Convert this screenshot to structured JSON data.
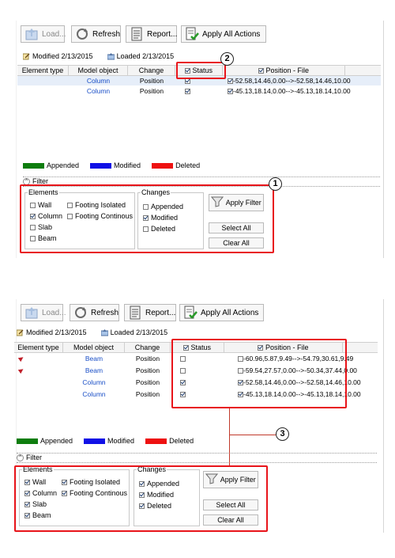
{
  "toolbar": {
    "load": "Load...",
    "refresh": "Refresh",
    "report": "Report...",
    "apply_all": "Apply All Actions"
  },
  "status": {
    "modified": "Modified 2/13/2015",
    "loaded": "Loaded 2/13/2015"
  },
  "grid": {
    "columns": [
      "Element type",
      "Model object",
      "Change",
      "Status",
      "Position - File"
    ],
    "rows_top": [
      {
        "element_type": "",
        "model_object": "Column",
        "change": "Position",
        "status": true,
        "file_checked": true,
        "position": "-52.58,14.46,0.00-->-52.58,14.46,10.00"
      },
      {
        "element_type": "",
        "model_object": "Column",
        "change": "Position",
        "status": true,
        "file_checked": true,
        "position": "-45.13,18.14,0.00-->-45.13,18.14,10.00"
      }
    ],
    "rows_bottom": [
      {
        "element_type": "",
        "model_object": "Beam",
        "change": "Position",
        "status": false,
        "file_checked": false,
        "position": "-60.96,5.87,9.49-->-54.79,30.61,9.49"
      },
      {
        "element_type": "",
        "model_object": "Beam",
        "change": "Position",
        "status": false,
        "file_checked": false,
        "position": "-59.54,27.57,0.00-->-50.34,37.44,0.00"
      },
      {
        "element_type": "",
        "model_object": "Column",
        "change": "Position",
        "status": true,
        "file_checked": true,
        "position": "-52.58,14.46,0.00-->-52.58,14.46,10.00"
      },
      {
        "element_type": "",
        "model_object": "Column",
        "change": "Position",
        "status": true,
        "file_checked": true,
        "position": "-45.13,18.14,0.00-->-45.13,18.14,10.00"
      }
    ]
  },
  "legend": {
    "appended": "Appended",
    "modified": "Modified",
    "deleted": "Deleted",
    "appended_color": "#0e7d0e",
    "modified_color": "#1010e6",
    "deleted_color": "#ee1111"
  },
  "filter": {
    "label": "Filter",
    "elements_title": "Elements",
    "changes_title": "Changes",
    "wall": "Wall",
    "column": "Column",
    "slab": "Slab",
    "beam": "Beam",
    "footing_isolated": "Footing Isolated",
    "footing_continous": "Footing Continous",
    "appended": "Appended",
    "modified": "Modified",
    "deleted": "Deleted",
    "apply_filter": "Apply Filter",
    "select_all": "Select All",
    "clear_all": "Clear All"
  },
  "callouts": {
    "one": "1",
    "two": "2",
    "three": "3"
  },
  "icons": [
    "load-icon",
    "refresh-icon",
    "report-icon",
    "apply-all-icon",
    "modified-icon",
    "loaded-icon",
    "funnel-icon",
    "expand-chevron-icon",
    "deleted-arrow-icon"
  ]
}
